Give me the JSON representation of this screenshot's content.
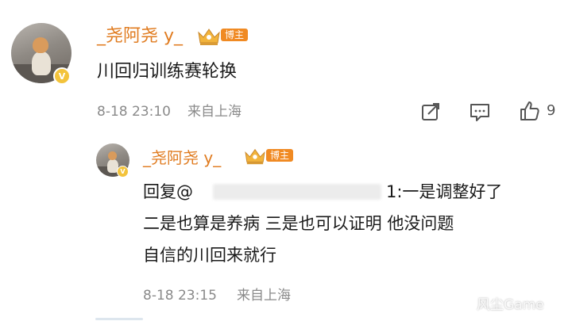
{
  "comment": {
    "username": "_尧阿尧 y_",
    "tag": "博主",
    "text": "川回归训练赛轮换",
    "time": "8-18 23:10",
    "location": "来自上海",
    "like_count": "9"
  },
  "reply": {
    "username": "_尧阿尧 y_",
    "tag": "博主",
    "reply_prefix": "回复@",
    "line1_tail": "1:一是调整好了",
    "line2": "二是也算是养病  三是也可以证明  他没问题",
    "line3": "自信的川回来就行",
    "time": "8-18 23:15",
    "location": "来自上海"
  },
  "watermark": "风尘Game",
  "colors": {
    "username": "#e07b1f",
    "tag_bg": "#f08a23",
    "verified_badge": "#f3c33b",
    "meta_text": "#8a8a8a"
  },
  "icons": [
    "share-icon",
    "comment-icon",
    "like-icon",
    "crown-icon",
    "verified-icon"
  ]
}
